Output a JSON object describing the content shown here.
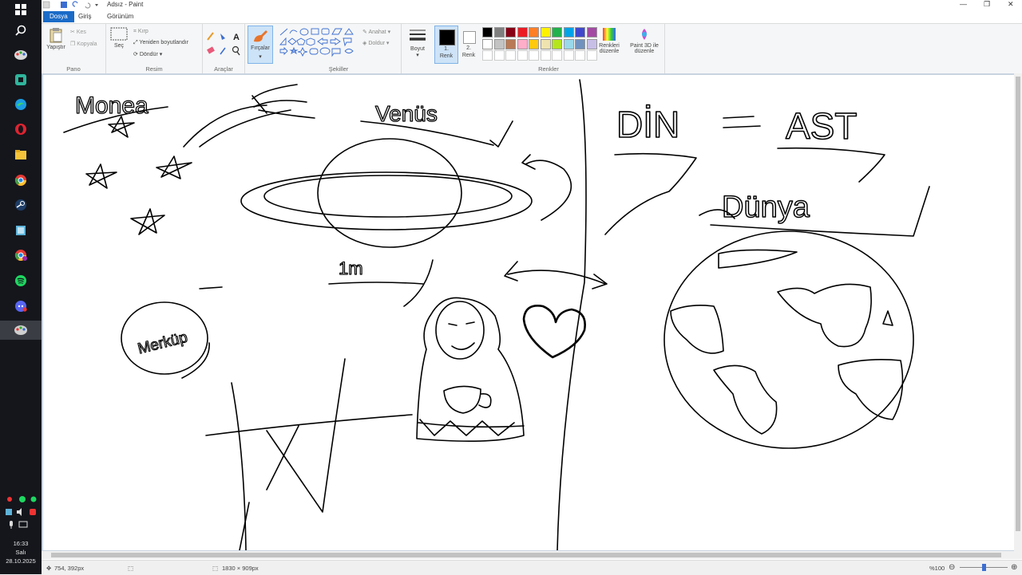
{
  "window": {
    "title": "Adsız - Paint",
    "minimize": "—",
    "restore": "❐",
    "close": "✕"
  },
  "tabs": {
    "file": "Dosya",
    "home": "Giriş",
    "view": "Görünüm"
  },
  "ribbon": {
    "clipboard": {
      "paste": "Yapıştır",
      "cut": "Kes",
      "copy": "Kopyala",
      "group": "Pano"
    },
    "image": {
      "select": "Seç",
      "crop": "Kırp",
      "resize": "Yeniden boyutlandır",
      "rotate": "Döndür",
      "group": "Resim"
    },
    "tools": {
      "group": "Araçlar"
    },
    "brushes": {
      "label": "Fırçalar"
    },
    "shapes": {
      "outline": "Anahat",
      "fill": "Doldur",
      "group": "Şekiller"
    },
    "size": {
      "label": "Boyut"
    },
    "colors": {
      "color1_num": "1.",
      "color1_word": "Renk",
      "color2_num": "2.",
      "color2_word": "Renk",
      "edit_line1": "Renkleri",
      "edit_line2": "düzenle",
      "paint3d_line1": "Paint 3D ile",
      "paint3d_line2": "düzenle",
      "group": "Renkler",
      "palette": [
        "#000000",
        "#7f7f7f",
        "#880015",
        "#ed1c24",
        "#ff7f27",
        "#fff200",
        "#22b14c",
        "#00a2e8",
        "#3f48cc",
        "#a349a4",
        "#ffffff",
        "#c3c3c3",
        "#b97a57",
        "#ffaec9",
        "#ffc90e",
        "#efe4b0",
        "#b5e61d",
        "#99d9ea",
        "#7092be",
        "#c8bfe7"
      ]
    }
  },
  "canvas_text": {
    "monea": "Monea",
    "venus": "Venüs",
    "din": "DİN",
    "ast": "AST",
    "dunya": "Dünya",
    "merkur": "Merküp",
    "one_m": "1m"
  },
  "status": {
    "cursor_pos": "754, 392px",
    "canvas_size": "1830 × 909px",
    "zoom": "%100"
  },
  "taskbar": {
    "time": "16:33",
    "day": "Salı",
    "date": "28.10.2025",
    "icons": [
      "windows-icon",
      "search-icon",
      "paint-app-icon",
      "teams-icon",
      "edge-icon",
      "opera-icon",
      "file-explorer-icon",
      "chrome-icon",
      "steam-icon",
      "notes-icon",
      "chrome-alt-icon",
      "spotify-icon",
      "discord-icon",
      "paint-active-icon"
    ]
  }
}
